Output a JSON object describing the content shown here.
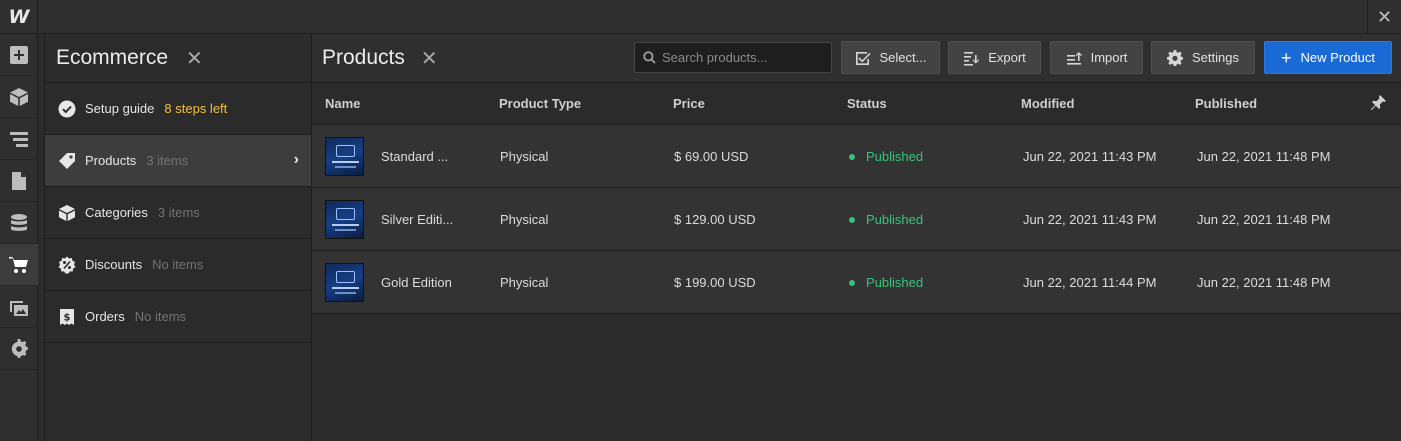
{
  "app": {
    "logo": "W",
    "close": "✕"
  },
  "sidebar_icons": [
    "add-icon",
    "box-icon",
    "navigator-icon",
    "pages-icon",
    "cms-icon",
    "ecommerce-cart-icon",
    "assets-icon",
    "settings-icon"
  ],
  "ecommerce_panel": {
    "title": "Ecommerce",
    "close": "✕",
    "items": [
      {
        "label": "Setup guide",
        "badge": "8 steps left",
        "icon": "check-circle-icon"
      },
      {
        "label": "Products",
        "count": "3 items",
        "icon": "tag-icon"
      },
      {
        "label": "Categories",
        "count": "3 items",
        "icon": "box-icon"
      },
      {
        "label": "Discounts",
        "count": "No items",
        "icon": "discount-badge-icon"
      },
      {
        "label": "Orders",
        "count": "No items",
        "icon": "receipt-icon"
      }
    ]
  },
  "products": {
    "title": "Products",
    "close": "✕",
    "search": {
      "placeholder": "Search products...",
      "value": ""
    },
    "toolbar": {
      "select": "Select...",
      "export": "Export",
      "import": "Import",
      "settings": "Settings",
      "new_product": "New Product"
    },
    "columns": [
      "Name",
      "Product Type",
      "Price",
      "Status",
      "Modified",
      "Published"
    ],
    "rows": [
      {
        "name": "Standard ...",
        "type": "Physical",
        "price": "$ 69.00 USD",
        "status": "Published",
        "modified": "Jun 22, 2021 11:43 PM",
        "published": "Jun 22, 2021 11:48 PM"
      },
      {
        "name": "Silver Editi...",
        "type": "Physical",
        "price": "$ 129.00 USD",
        "status": "Published",
        "modified": "Jun 22, 2021 11:43 PM",
        "published": "Jun 22, 2021 11:48 PM"
      },
      {
        "name": "Gold Edition",
        "type": "Physical",
        "price": "$ 199.00 USD",
        "status": "Published",
        "modified": "Jun 22, 2021 11:44 PM",
        "published": "Jun 22, 2021 11:48 PM"
      }
    ]
  },
  "colors": {
    "accent": "#1a6ad5",
    "status_published": "#35c47c",
    "warning": "#f3c03b"
  }
}
